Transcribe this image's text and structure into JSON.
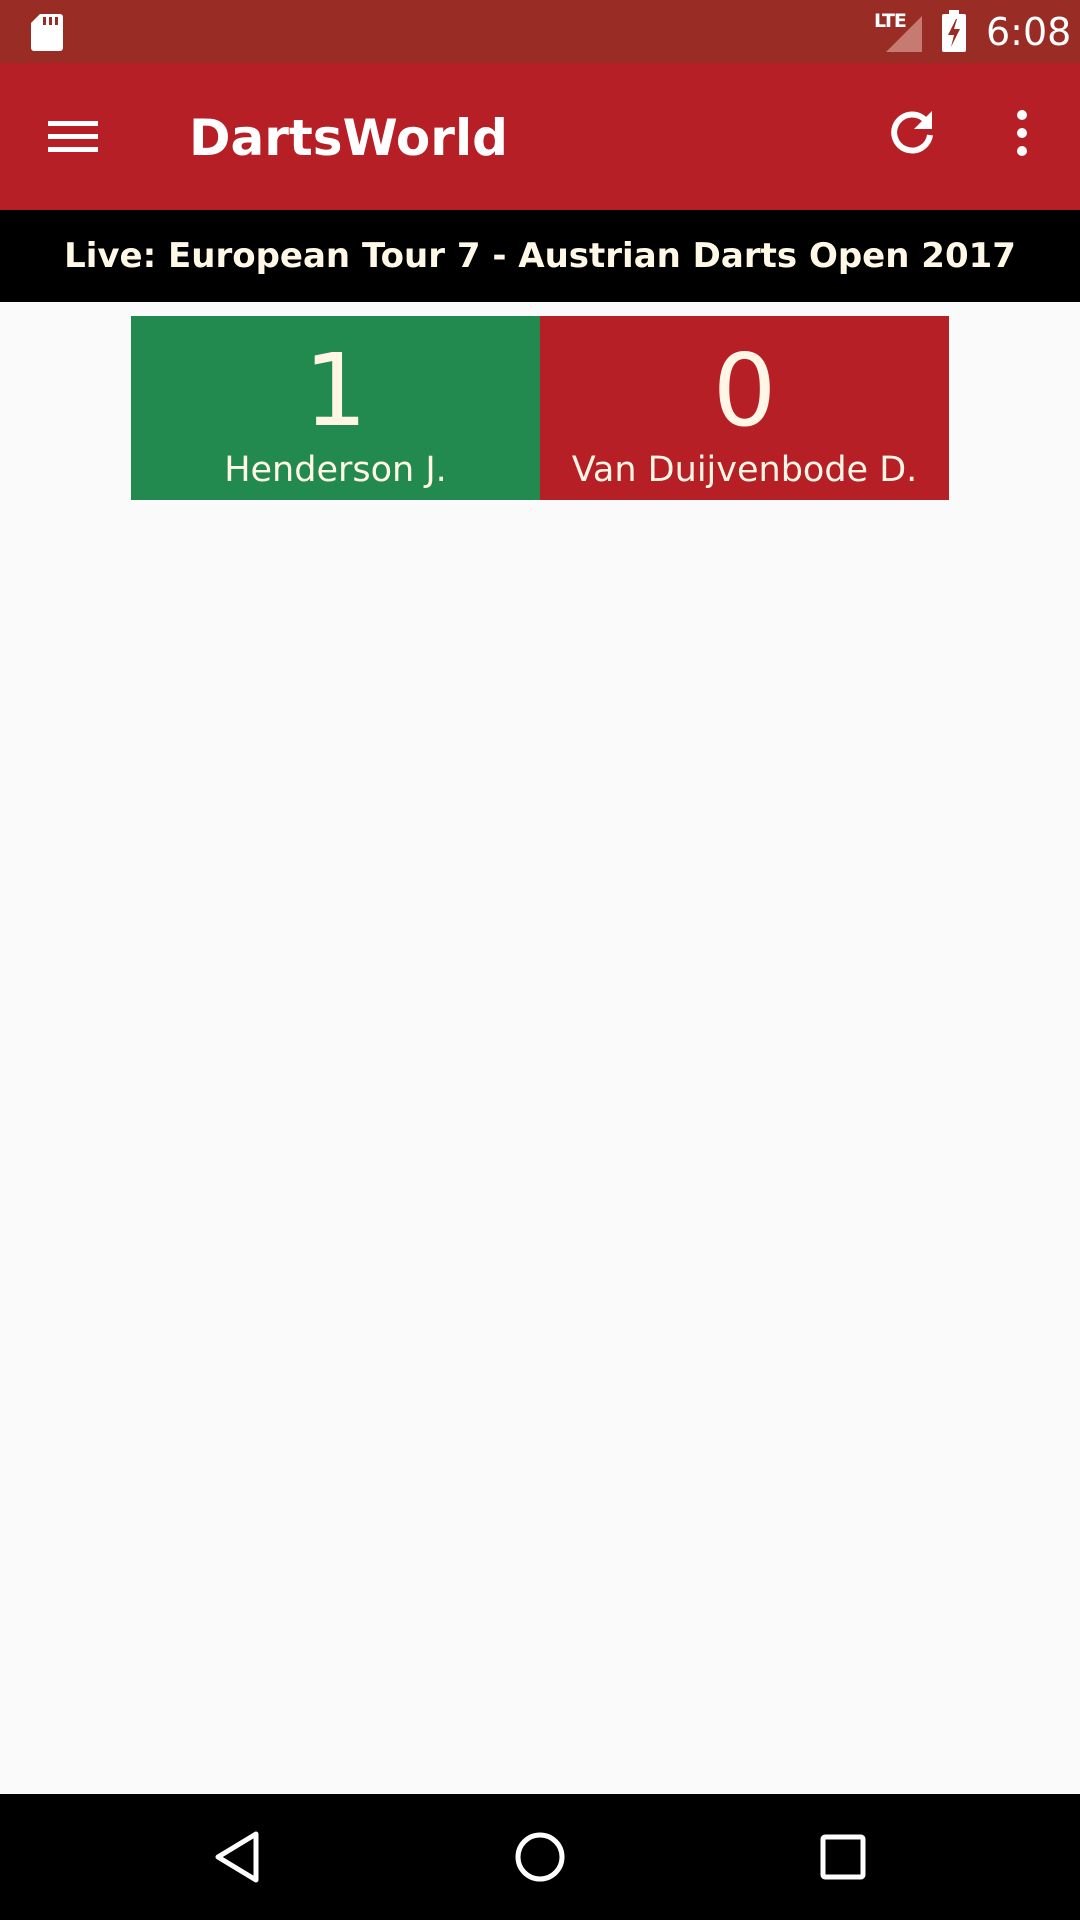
{
  "status_bar": {
    "network_label": "LTE",
    "time": "6:08",
    "icons": [
      "sd-card-icon",
      "signal-icon",
      "battery-charging-icon"
    ]
  },
  "app_bar": {
    "title": "DartsWorld",
    "icons": [
      "menu-icon",
      "refresh-icon",
      "more-vert-icon"
    ]
  },
  "live_banner": {
    "text": "Live: European Tour 7 - Austrian Darts Open 2017"
  },
  "match": {
    "home": {
      "score": "1",
      "name": "Henderson J.",
      "color": "#228a4e"
    },
    "away": {
      "score": "0",
      "name": "Van Duijvenbode D.",
      "color": "#b71f26"
    }
  },
  "nav_bar": {
    "icons": [
      "back-icon",
      "home-icon",
      "recents-icon"
    ]
  },
  "colors": {
    "status_bar": "#992d25",
    "app_bar": "#b71f26",
    "banner": "#000000",
    "background": "#fafafa"
  }
}
